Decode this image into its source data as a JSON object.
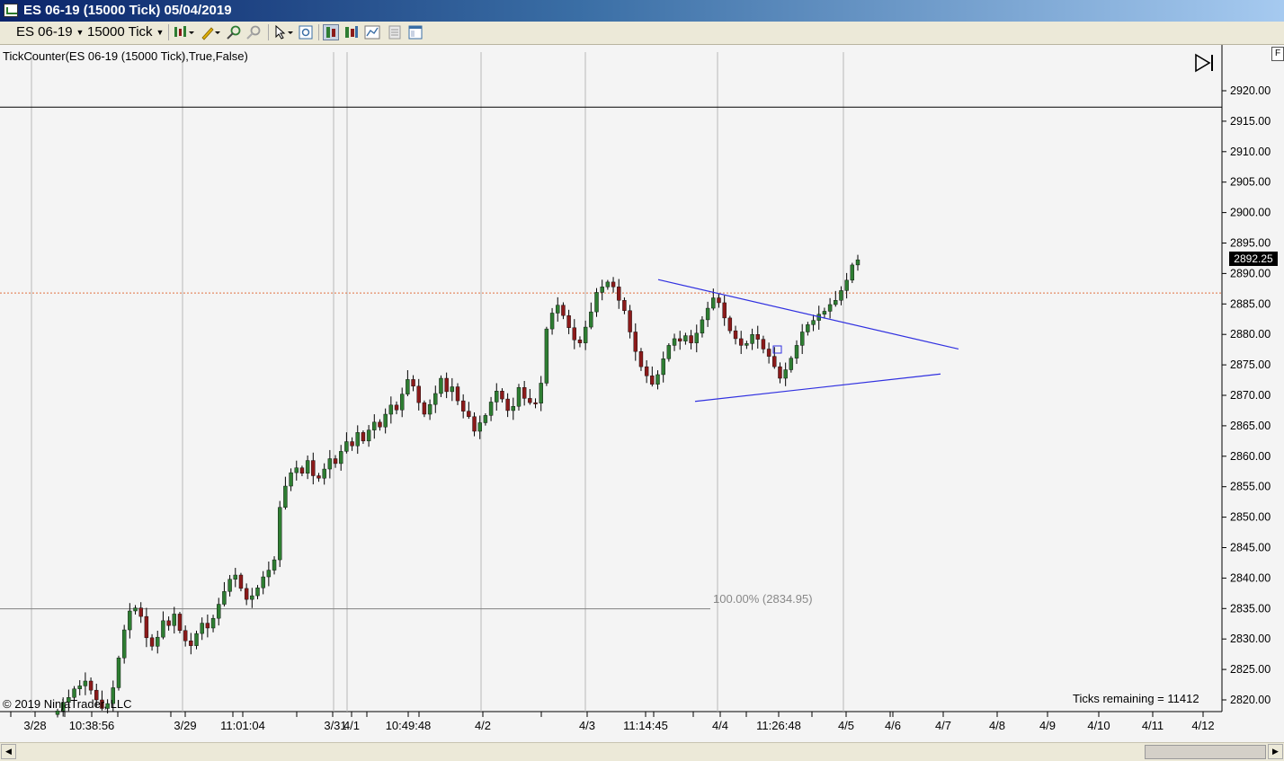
{
  "window": {
    "title": "ES 06-19 (15000 Tick)  05/04/2019"
  },
  "toolbar": {
    "instrument": "ES 06-19",
    "interval": "15000 Tick",
    "icons": [
      "bar-type-icon",
      "drawing-tool-icon",
      "zoom-in-icon",
      "zoom-out-icon",
      "cursor-icon",
      "data-box-icon",
      "chart-trader-icon",
      "properties-icon",
      "strategies-icon",
      "chart-panel-icon",
      "window-linking-icon"
    ]
  },
  "chart": {
    "indicator_label": "TickCounter(ES  06-19 (15000  Tick),True,False)",
    "copyright": "© 2019 NinjaTrader, LLC",
    "ticks_remaining": "Ticks remaining = 11412",
    "last_price": "2892.25",
    "fib_label": "100.00% (2834.95)",
    "price_axis": [
      "2920.00",
      "2915.00",
      "2910.00",
      "2905.00",
      "2900.00",
      "2895.00",
      "2890.00",
      "2885.00",
      "2880.00",
      "2875.00",
      "2870.00",
      "2865.00",
      "2860.00",
      "2855.00",
      "2850.00",
      "2845.00",
      "2840.00",
      "2835.00",
      "2830.00",
      "2825.00",
      "2820.00"
    ],
    "time_axis": [
      "3/28",
      "10:38:56",
      "3/29",
      "11:01:04",
      "3/31",
      "4/1",
      "10:49:48",
      "4/2",
      "4/3",
      "11:14:45",
      "4/4",
      "11:26:48",
      "4/5",
      "4/6",
      "4/7",
      "4/8",
      "4/9",
      "4/10",
      "4/11",
      "4/12"
    ],
    "colors": {
      "up_candle": "#2e7d32",
      "down_candle": "#8b1a1a",
      "trendline": "#3030e0",
      "horizontal_line": "#000000",
      "ask_line": "#e07040",
      "fib_line": "#808080"
    }
  },
  "chart_data": {
    "type": "candlestick",
    "ylim": [
      2818,
      2925
    ],
    "horizontal_lines": [
      2917.3,
      2886.8,
      2834.95
    ],
    "trendlines": [
      {
        "from": [
          732,
          2889.0
        ],
        "to": [
          1066,
          2877.6
        ]
      },
      {
        "from": [
          773,
          2869.0
        ],
        "to": [
          1046,
          2873.5
        ]
      }
    ],
    "closes": [
      2818.2,
      2819.6,
      2820.4,
      2821.8,
      2822.3,
      2823.1,
      2821.6,
      2820.0,
      2818.6,
      2819.4,
      2822.0,
      2826.9,
      2831.5,
      2834.6,
      2835.1,
      2833.7,
      2830.2,
      2828.8,
      2830.3,
      2833.0,
      2832.2,
      2834.1,
      2831.4,
      2829.7,
      2828.9,
      2830.9,
      2832.6,
      2831.8,
      2833.4,
      2835.7,
      2837.8,
      2839.8,
      2840.5,
      2838.3,
      2836.5,
      2837.1,
      2838.4,
      2840.2,
      2841.3,
      2843.0,
      2851.6,
      2855.1,
      2857.3,
      2858.1,
      2857.2,
      2859.3,
      2856.8,
      2856.4,
      2857.9,
      2859.6,
      2858.8,
      2860.8,
      2862.4,
      2861.7,
      2863.9,
      2862.5,
      2864.3,
      2865.6,
      2864.8,
      2866.9,
      2868.4,
      2867.6,
      2870.2,
      2872.6,
      2871.5,
      2868.8,
      2866.9,
      2868.5,
      2870.3,
      2872.8,
      2870.6,
      2871.4,
      2869.1,
      2867.4,
      2866.5,
      2864.1,
      2865.5,
      2866.7,
      2868.9,
      2870.7,
      2869.4,
      2867.5,
      2868.2,
      2871.3,
      2869.5,
      2868.8,
      2868.7,
      2872.0,
      2880.9,
      2883.5,
      2884.8,
      2883.1,
      2881.1,
      2879.1,
      2878.6,
      2881.2,
      2883.7,
      2886.9,
      2887.8,
      2888.6,
      2887.8,
      2885.6,
      2883.9,
      2880.4,
      2877.2,
      2874.7,
      2873.2,
      2871.8,
      2873.4,
      2876.0,
      2878.2,
      2879.3,
      2878.9,
      2879.8,
      2878.6,
      2880.2,
      2882.4,
      2884.3,
      2886.0,
      2885.2,
      2882.7,
      2880.6,
      2879.3,
      2878.2,
      2878.5,
      2880.0,
      2879.2,
      2877.6,
      2876.4,
      2874.7,
      2872.8,
      2874.2,
      2876.1,
      2878.2,
      2880.4,
      2881.6,
      2882.3,
      2883.3,
      2883.8,
      2884.9,
      2885.6,
      2887.2,
      2888.9,
      2891.4,
      2892.25
    ]
  }
}
